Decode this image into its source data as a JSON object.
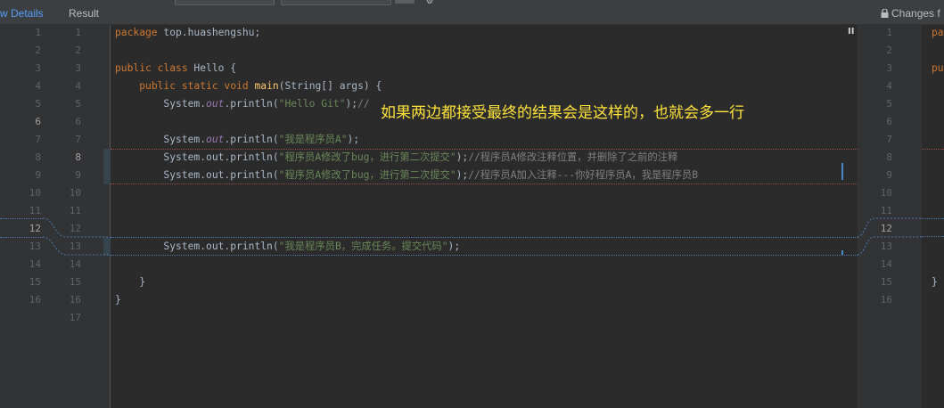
{
  "header": {
    "tab_details": "w Details",
    "tab_result": "Result",
    "changes_label": "Changes f"
  },
  "gutter_left_a": [
    "1",
    "2",
    "3",
    "4",
    "5",
    "6",
    "7",
    "8",
    "9",
    "10",
    "11",
    "12",
    "13",
    "14",
    "15",
    "16"
  ],
  "gutter_left_b": [
    "1",
    "2",
    "3",
    "4",
    "5",
    "6",
    "7",
    "8",
    "9",
    "10",
    "11",
    "12",
    "13",
    "14",
    "15",
    "16",
    "17"
  ],
  "gutter_right": [
    "1",
    "2",
    "3",
    "4",
    "5",
    "6",
    "7",
    "8",
    "9",
    "10",
    "11",
    "12",
    "13",
    "14",
    "15",
    "16"
  ],
  "code": {
    "l1_kw": "package",
    "l1_rest": " top.huashengshu;",
    "l3_kw": "public class",
    "l3_rest": " Hello {",
    "l4_kw": "public static void",
    "l4_fn": "main",
    "l4_rest": "(String[] args) {",
    "l5_a": "System.",
    "l5_out": "out",
    "l5_b": ".println(",
    "l5_str": "\"Hello Git\"",
    "l5_c": ");",
    "l5_cmt": "//",
    "l7_a": "System.",
    "l7_out": "out",
    "l7_b": ".println(",
    "l7_str": "\"我是程序员A\"",
    "l7_c": ");",
    "l8_a": "System.out.println(",
    "l8_str": "\"程序员A修改了bug，进行第二次提交\"",
    "l8_c": ");",
    "l8_cmt": "//程序员A修改注释位置，并删除了之前的注释",
    "l9_a": "System.out.println(",
    "l9_str": "\"程序员A修改了bug，进行第二次提交\"",
    "l9_c": ");",
    "l9_cmt": "//程序员A加入注释---你好程序员A，我是程序员B",
    "l13_a": "System.out.println(",
    "l13_str": "\"我是程序员B，完成任务。提交代码\"",
    "l13_c": ");",
    "l15": "}",
    "l16": "}"
  },
  "right_code": {
    "r1": "pa",
    "r3": "pu",
    "r15": "}"
  },
  "annotation": "如果两边都接受最终的结果会是这样的，也就会多一行",
  "colors": {
    "background": "#2b2b2b",
    "gutter": "#313335",
    "keyword": "#cc7832",
    "string": "#6a8759",
    "comment": "#808080",
    "annotation": "#ffe33a",
    "accent": "#589df6"
  }
}
